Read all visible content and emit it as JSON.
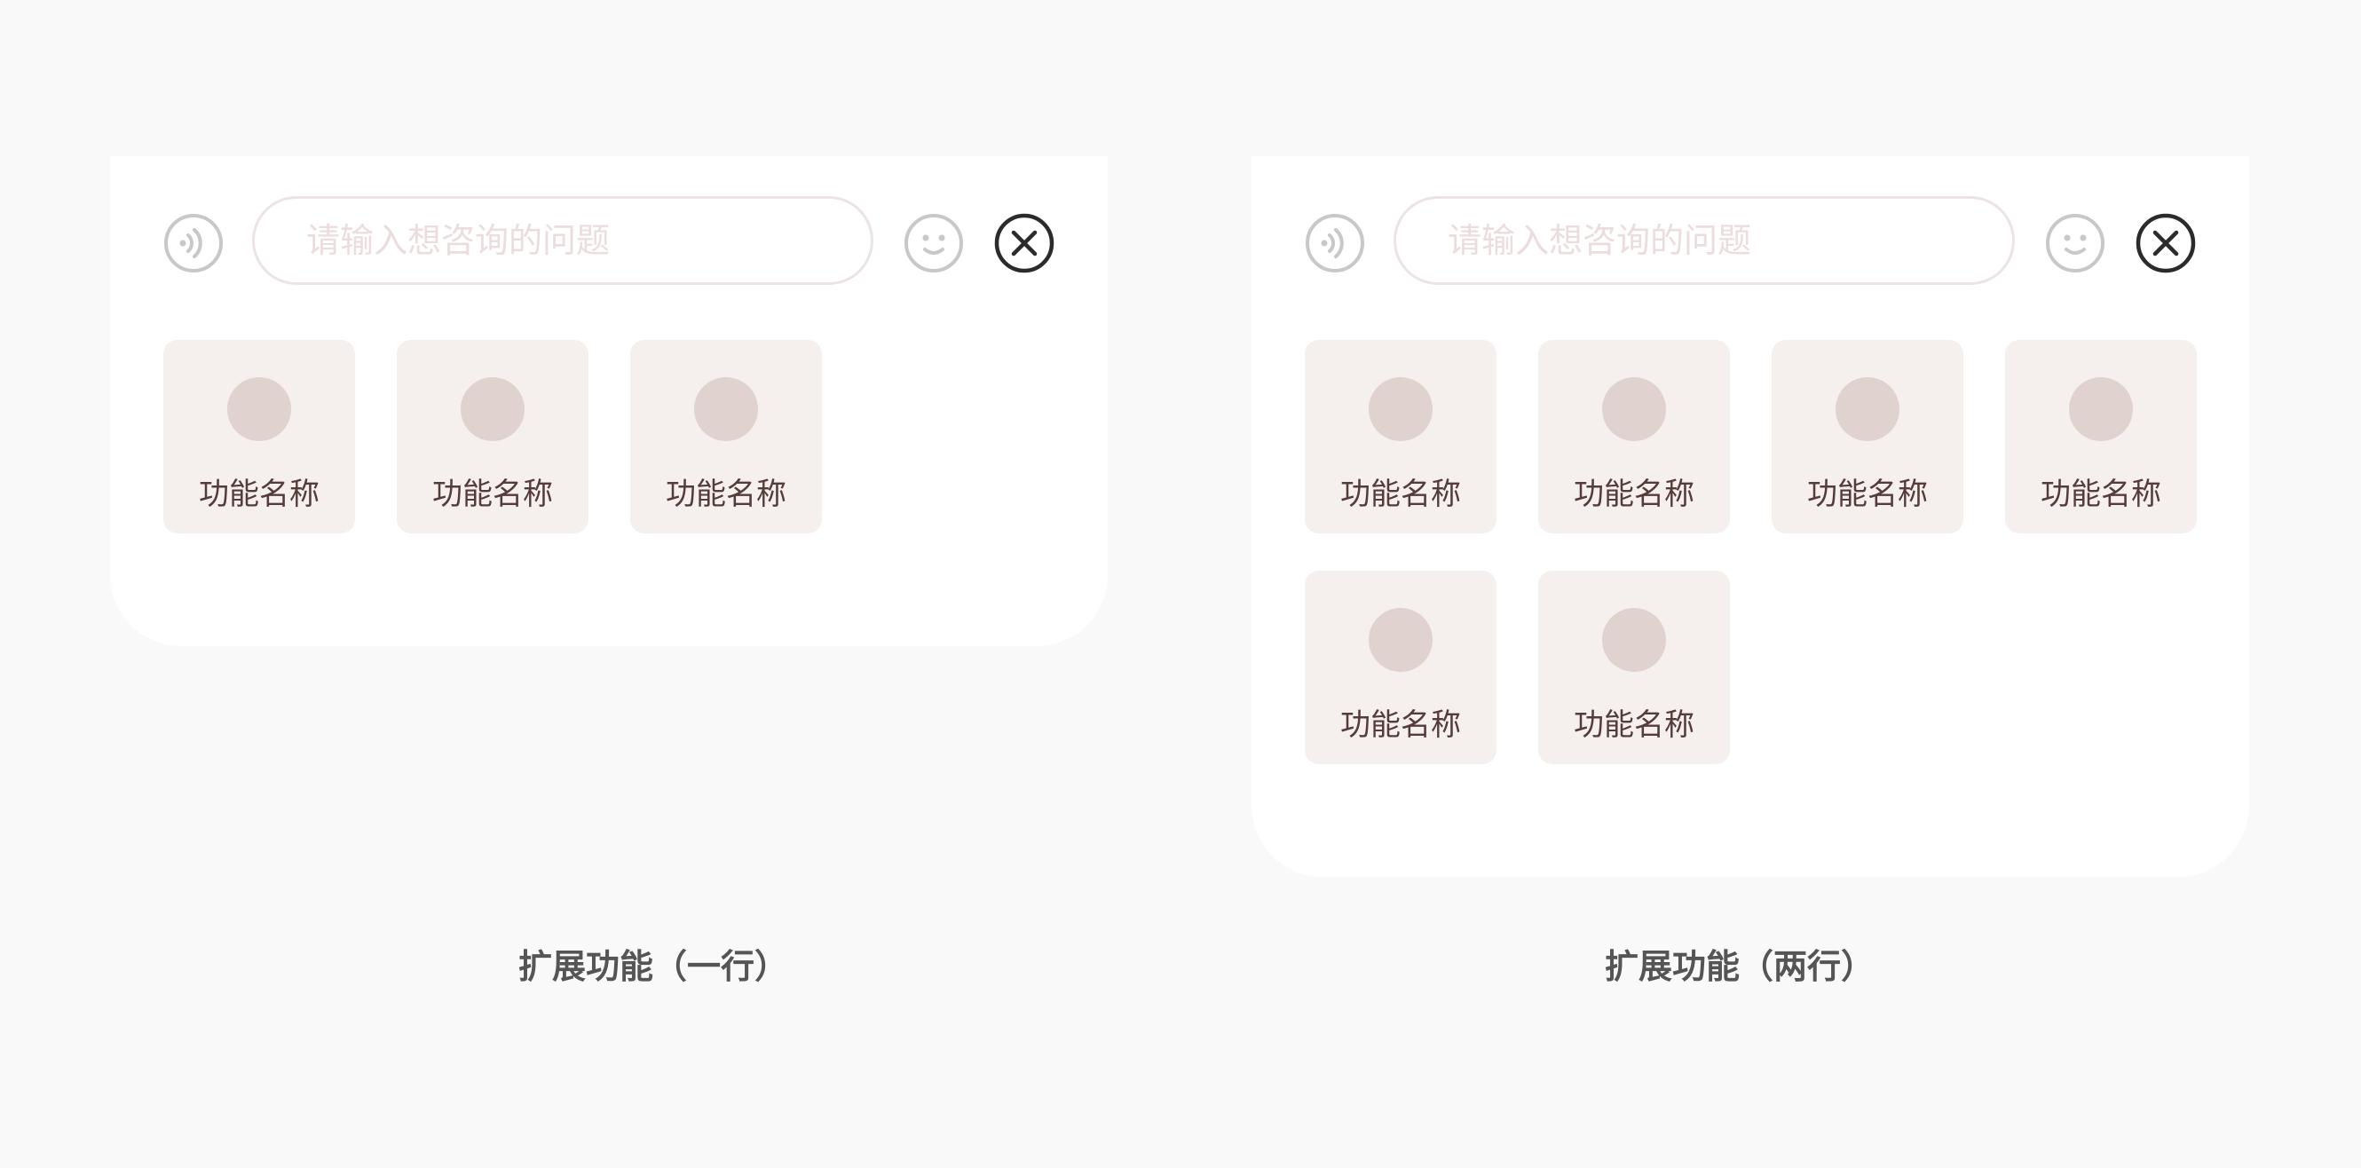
{
  "colors": {
    "page_bg": "#f9f9f9",
    "panel_bg": "#ffffff",
    "tile_bg": "#f5efed",
    "tile_dot": "#e0d2cf",
    "tile_label": "#553c3a",
    "placeholder": "#ecdcdd",
    "icon_gray": "#c8c8c8",
    "close_icon": "#2b2b2b",
    "caption": "#555555"
  },
  "icons": {
    "voice": "voice-wave-icon",
    "emoji": "smiley-face-icon",
    "close": "close-circle-icon",
    "tile": "function-placeholder-icon"
  },
  "panels": [
    {
      "input_placeholder": "请输入想咨询的问题",
      "tiles": [
        {
          "label": "功能名称"
        },
        {
          "label": "功能名称"
        },
        {
          "label": "功能名称"
        }
      ],
      "caption": "扩展功能（一行）"
    },
    {
      "input_placeholder": "请输入想咨询的问题",
      "tiles": [
        {
          "label": "功能名称"
        },
        {
          "label": "功能名称"
        },
        {
          "label": "功能名称"
        },
        {
          "label": "功能名称"
        },
        {
          "label": "功能名称"
        },
        {
          "label": "功能名称"
        }
      ],
      "caption": "扩展功能（两行）"
    }
  ]
}
